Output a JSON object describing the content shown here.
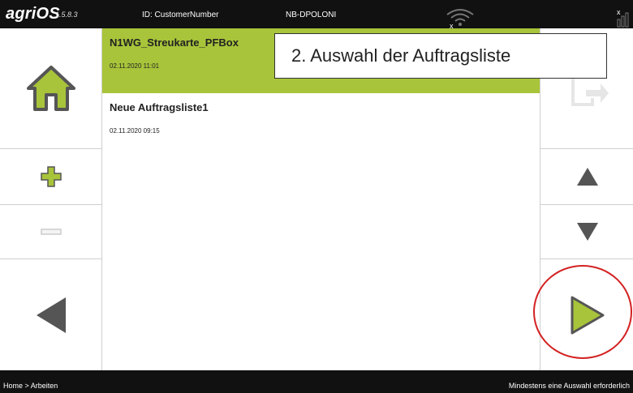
{
  "header": {
    "brand": "agriOS",
    "version": "1.5.8.3",
    "customer_id": "ID: CustomerNumber",
    "device": "NB-DPOLONI",
    "wifi_icon": "wifi-disconnected-icon",
    "signal_icon": "signal-none-icon"
  },
  "sidebar_left": {
    "home_icon": "home-icon",
    "add_icon": "plus-icon",
    "remove_icon": "minus-icon",
    "back_icon": "back-arrow-icon"
  },
  "sidebar_right": {
    "export_icon": "export-icon",
    "up_icon": "arrow-up-icon",
    "down_icon": "arrow-down-icon",
    "next_icon": "next-arrow-icon"
  },
  "list": {
    "items": [
      {
        "name": "N1WG_Streukarte_PFBox",
        "date": "02.11.2020 11:01",
        "selected": true
      },
      {
        "name": "Neue Auftragsliste1",
        "date": "02.11.2020 09:15",
        "selected": false
      }
    ]
  },
  "callout": "2. Auswahl der Auftragsliste",
  "footer": {
    "breadcrumb": "Home > Arbeiten",
    "status": "Mindestens eine Auswahl erforderlich"
  },
  "colors": {
    "accent_green": "#a8c43a",
    "highlight_red": "#d42222",
    "bar_dark": "#111111"
  }
}
